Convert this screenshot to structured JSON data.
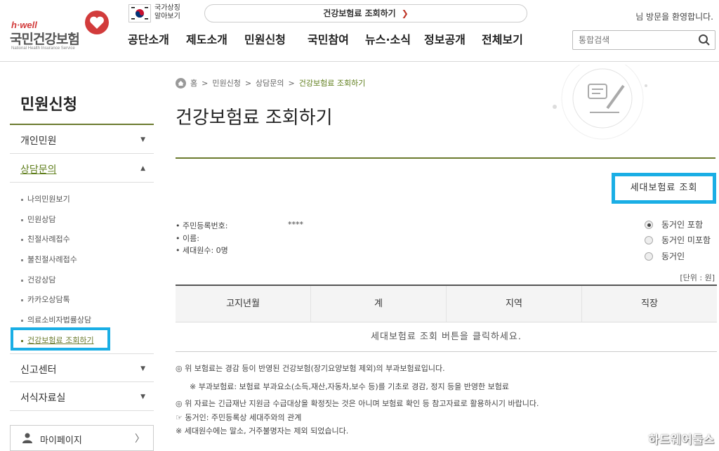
{
  "header": {
    "brand_tag": "h·well",
    "brand_name": "국민건강보험",
    "brand_sub": "National Health Insurance Service",
    "symbol_line1": "국가상징",
    "symbol_line2": "알아보기",
    "top_link": "건강보험료 조회하기",
    "top_link_arrow": "❯",
    "welcome": "님 방문을 환영합니다.",
    "nav": [
      "공단소개",
      "제도소개",
      "민원신청",
      "국민참여",
      "뉴스·소식",
      "정보공개",
      "전체보기"
    ],
    "search_placeholder": "통합검색"
  },
  "sidebar": {
    "title": "민원신청",
    "items": [
      {
        "label": "개인민원",
        "chev": "▼"
      },
      {
        "label": "상담문의",
        "chev": "▲"
      },
      {
        "label": "신고센터",
        "chev": "▼"
      },
      {
        "label": "서식자료실",
        "chev": "▼"
      }
    ],
    "subitems": [
      "나의민원보기",
      "민원상담",
      "친절사례접수",
      "불친절사례접수",
      "건강상담",
      "카카오상담톡",
      "의료소비자법률상담",
      "건강보험료 조회하기"
    ],
    "mypage": "마이페이지",
    "mypage_chev": "〉"
  },
  "main": {
    "breadcrumb": [
      "홈",
      "민원신청",
      "상담문의",
      "건강보험료 조회하기"
    ],
    "breadcrumb_sep": ">",
    "title": "건강보험료 조회하기",
    "query_button": "세대보험료 조회",
    "info": [
      {
        "label": "• 주민등록번호:",
        "value": "****"
      },
      {
        "label": "• 이름:",
        "value": ""
      },
      {
        "label": "• 세대원수: 0명",
        "value": ""
      }
    ],
    "radios": [
      {
        "label": "동거인 포함",
        "checked": true
      },
      {
        "label": "동거인 미포함",
        "checked": false
      },
      {
        "label": "동거인",
        "checked": false
      }
    ],
    "unit": "[단위 : 원]",
    "table_headers": [
      "고지년월",
      "계",
      "지역",
      "직장"
    ],
    "table_empty": "세대보험료 조회 버튼을 클릭하세요.",
    "notes": [
      "◎ 위 보험료는 경감 등이 반영된 건강보험(장기요양보험 제외)의 부과보험료입니다.",
      "※ 부과보험료: 보험료 부과요소(소득,재산,자동차,보수 등)를 기초로 경감, 정지 등을 반영한 보험료",
      "◎ 위 자료는 긴급재난 지원금 수급대상을 확정짓는 것은 아니며 보험료 확인 등 참고자료로 활용하시기 바랍니다.",
      "☞ 동거인: 주민등록상 세대주와의 관계",
      "※ 세대원수에는 말소, 거주불명자는 제외 되었습니다."
    ]
  },
  "watermark": "하드웨어둘스",
  "colors": {
    "accent_olive": "#6b7a2e",
    "highlight_blue": "#1aaee5",
    "brand_red": "#d23b3b"
  }
}
